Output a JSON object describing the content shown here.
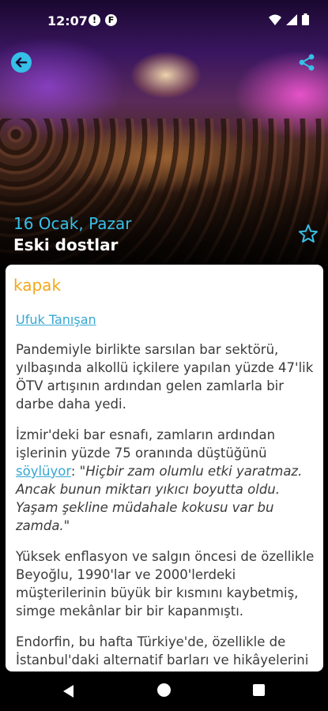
{
  "status_bar": {
    "time": "12:07"
  },
  "hero": {
    "date": "16 Ocak, Pazar",
    "title": "Eski dostlar"
  },
  "article": {
    "section": "kapak",
    "author": "Ufuk Tanışan",
    "p1": "Pandemiyle birlikte sarsılan bar sektörü, yılbaşında alkollü içkilere yapılan yüzde 47'lik ÖTV artışının ardından gelen zamlarla bir darbe daha yedi.",
    "p2_before": "İzmir'deki bar esnafı, zamların ardından işlerinin yüzde 75 oranında düştüğünü ",
    "p2_link": "söylüyor",
    "p2_colon": ": ",
    "p2_quote": "\"Hiçbir zam olumlu etki yaratmaz. Ancak bunun miktarı yıkıcı boyutta oldu. Yaşam şekline müdahale kokusu var bu zamda.\"",
    "p3": "Yüksek enflasyon ve salgın öncesi de özellikle Beyoğlu, 1990'lar ve 2000'lerdeki müşterilerinin büyük bir kısmını kaybetmiş, simge mekânlar bir bir kapanmıştı.",
    "p4": "Endorfin, bu hafta Türkiye'de, özellikle de İstanbul'daki alternatif barları ve hikâyelerini"
  },
  "colors": {
    "accent": "#36c0e8",
    "section": "#f0a81a",
    "link": "#36a7d3"
  }
}
